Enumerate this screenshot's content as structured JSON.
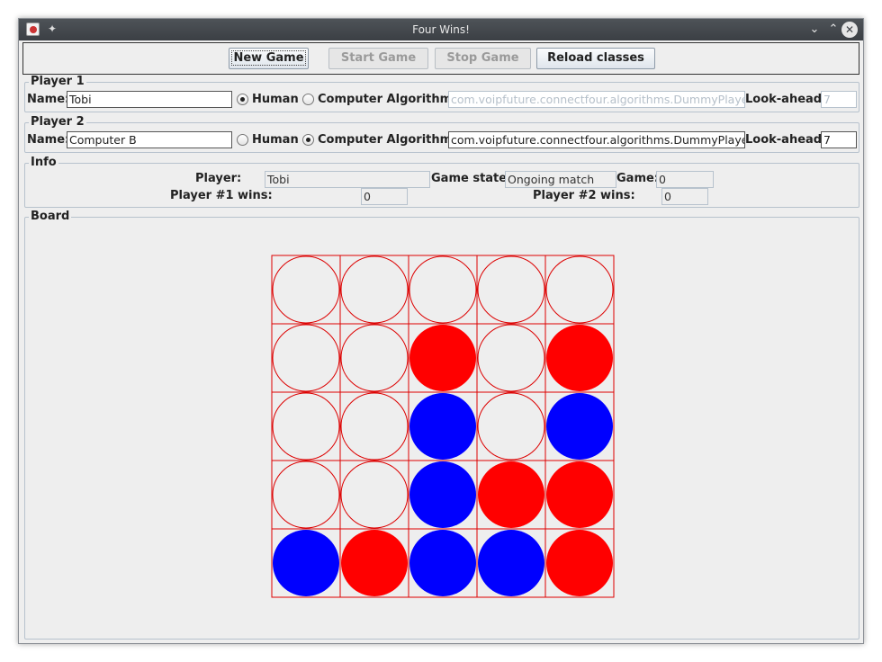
{
  "window": {
    "title": "Four Wins!"
  },
  "toolbar": {
    "new_game": "New Game",
    "start_game": "Start Game",
    "stop_game": "Stop Game",
    "reload_classes": "Reload classes"
  },
  "player1": {
    "legend": "Player 1",
    "name_label": "Name:",
    "name_value": "Tobi",
    "human_label": "Human",
    "computer_label": "Computer Algorithm:",
    "algorithm_value": "com.voipfuture.connectfour.algorithms.DummyPlayer",
    "lookahead_label": "Look-ahead:",
    "lookahead_value": "7",
    "selected": "human"
  },
  "player2": {
    "legend": "Player 2",
    "name_label": "Name:",
    "name_value": "Computer B",
    "human_label": "Human",
    "computer_label": "Computer Algorithm:",
    "algorithm_value": "com.voipfuture.connectfour.algorithms.DummyPlayer",
    "lookahead_label": "Look-ahead:",
    "lookahead_value": "7",
    "selected": "computer"
  },
  "info": {
    "legend": "Info",
    "player_label": "Player:",
    "player_value": "Tobi",
    "game_state_label": "Game state:",
    "game_state_value": "Ongoing match",
    "game_label": "Game:",
    "game_value": "0",
    "p1_wins_label": "Player #1 wins:",
    "p1_wins_value": "0",
    "p2_wins_label": "Player #2 wins:",
    "p2_wins_value": "0"
  },
  "board": {
    "legend": "Board",
    "colors": {
      "red": "#ff0000",
      "blue": "#0000ff",
      "empty": "#eeeeee",
      "grid": "#dd0000"
    },
    "cells": [
      [
        "empty",
        "empty",
        "empty",
        "empty",
        "empty"
      ],
      [
        "empty",
        "empty",
        "red",
        "empty",
        "red"
      ],
      [
        "empty",
        "empty",
        "blue",
        "empty",
        "blue"
      ],
      [
        "empty",
        "empty",
        "blue",
        "red",
        "red"
      ],
      [
        "blue",
        "red",
        "blue",
        "blue",
        "red"
      ]
    ]
  }
}
